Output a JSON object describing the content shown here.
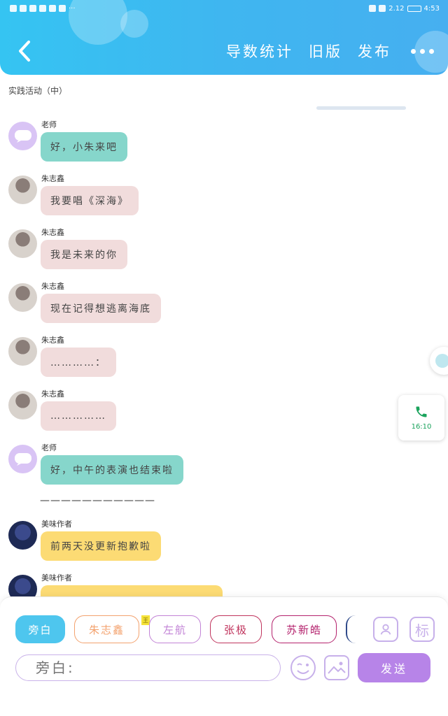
{
  "status_bar": {
    "battery": "2.12",
    "time": "4:53"
  },
  "header": {
    "nav": [
      "导数统计",
      "旧版",
      "发布"
    ]
  },
  "activity_label": "实践活动（中）",
  "messages": [
    {
      "sender": "老师",
      "text": "好，小朱来吧",
      "kind": "teacher"
    },
    {
      "sender": "朱志鑫",
      "text": "我要唱《深海》",
      "kind": "user"
    },
    {
      "sender": "朱志鑫",
      "text": "我是未来的你",
      "kind": "user"
    },
    {
      "sender": "朱志鑫",
      "text": "现在记得想逃离海底",
      "kind": "user"
    },
    {
      "sender": "朱志鑫",
      "text": "…………：",
      "kind": "user"
    },
    {
      "sender": "朱志鑫",
      "text": "……………",
      "kind": "user"
    },
    {
      "sender": "老师",
      "text": "好，中午的表演也结束啦",
      "kind": "teacher"
    },
    {
      "sender": "美味作者",
      "text": "前两天没更新抱歉啦",
      "kind": "author"
    },
    {
      "sender": "美味作者",
      "text": "",
      "kind": "author"
    }
  ],
  "divider": "———————————",
  "call_card": {
    "time": "16:10"
  },
  "roles": [
    {
      "label": "旁白",
      "color": "#4ec6ee",
      "active": true
    },
    {
      "label": "朱志鑫",
      "color": "#f3a26e",
      "active": false
    },
    {
      "label": "左航",
      "color": "#c283d6",
      "active": false
    },
    {
      "label": "张极",
      "color": "#c0345d",
      "active": false
    },
    {
      "label": "苏新皓",
      "color": "#b4226d",
      "active": false
    }
  ],
  "crown_badge": "王",
  "tool_icons": {
    "profile": "person-icon",
    "tag": "标"
  },
  "composer": {
    "placeholder": "旁白:",
    "send_label": "发送"
  }
}
